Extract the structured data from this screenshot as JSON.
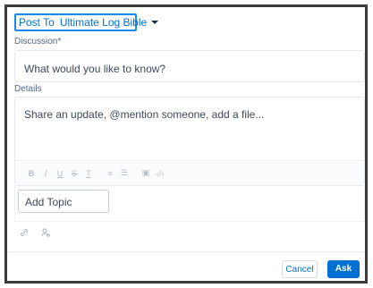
{
  "post_to": {
    "label": "Post To",
    "selected": "Ultimate Log Bible"
  },
  "discussion": {
    "label": "Discussion*",
    "placeholder": "What would you like to know?"
  },
  "details": {
    "label": "Details",
    "placeholder": "Share an update, @mention someone, add a file...",
    "toolbar": {
      "bold": "B",
      "italic": "I",
      "underline": "U",
      "strike": "S",
      "clear": "T",
      "ordered_list": "≡",
      "bullet_list": "☰",
      "image": "▣",
      "code": "‹/›"
    }
  },
  "topic": {
    "placeholder": "Add Topic"
  },
  "attachments": {
    "link_icon": "🔗",
    "mention_icon": "👤"
  },
  "footer": {
    "cancel": "Cancel",
    "ask": "Ask"
  }
}
